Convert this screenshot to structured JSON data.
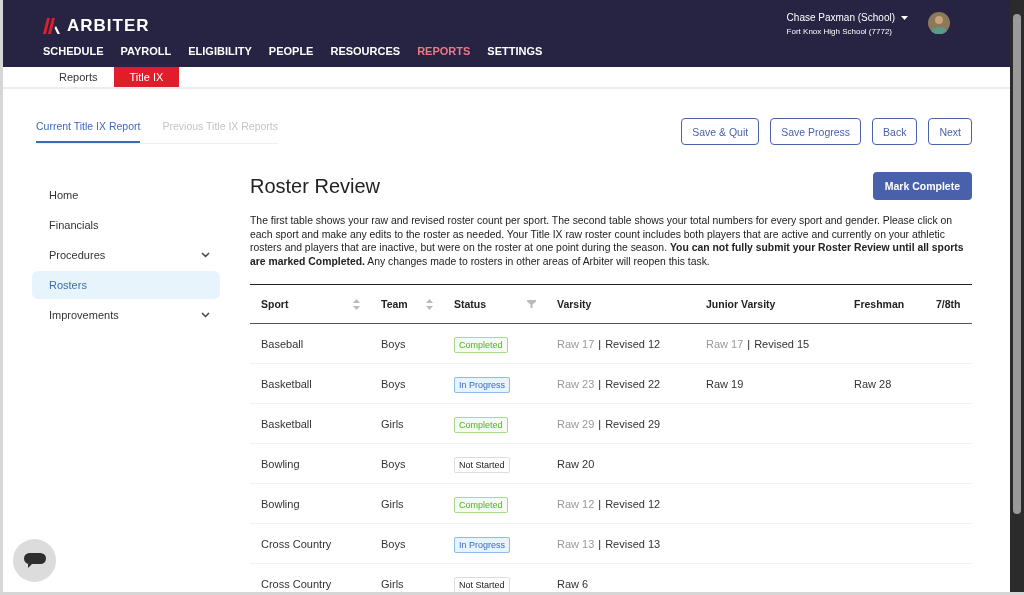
{
  "brand": {
    "name": "ARBITER"
  },
  "nav": [
    {
      "label": "SCHEDULE",
      "selected": false
    },
    {
      "label": "PAYROLL",
      "selected": false
    },
    {
      "label": "ELIGIBILITY",
      "selected": false
    },
    {
      "label": "PEOPLE",
      "selected": false
    },
    {
      "label": "RESOURCES",
      "selected": false
    },
    {
      "label": "REPORTS",
      "selected": true
    },
    {
      "label": "SETTINGS",
      "selected": false
    }
  ],
  "user": {
    "name": "Chase Paxman (School)",
    "school": "Fort Knox High School (7772)"
  },
  "subnav": [
    {
      "label": "Reports",
      "selected": false
    },
    {
      "label": "Title IX",
      "selected": true
    }
  ],
  "report_tabs": [
    {
      "label": "Current Title IX Report",
      "selected": true
    },
    {
      "label": "Previous Title IX Reports",
      "selected": false
    }
  ],
  "actions": [
    "Save & Quit",
    "Save Progress",
    "Back",
    "Next"
  ],
  "sidebar": {
    "items": [
      {
        "label": "Home",
        "selected": false
      },
      {
        "label": "Financials",
        "selected": false
      },
      {
        "label": "Procedures",
        "selected": false,
        "expandable": true
      },
      {
        "label": "Rosters",
        "selected": true
      },
      {
        "label": "Improvements",
        "selected": false,
        "expandable": true
      }
    ]
  },
  "title": "Roster Review",
  "mark_complete": "Mark Complete",
  "description": "The first table shows your raw and revised roster count per sport. The second table shows your total numbers for every sport and gender. Please click on each sport and make any edits to the roster as needed. Your Title IX raw roster count includes both players that are active and currently on your athletic rosters and players that are inactive, but were on the roster at one point during the season. **You can not fully submit your Roster Review until all sports are marked Completed.** Any changes made to rosters in other areas of Arbiter will reopen this task.",
  "table": {
    "columns": [
      {
        "label": "Sport",
        "sortable": true
      },
      {
        "label": "Team",
        "sortable": true
      },
      {
        "label": "Status",
        "filterable": true
      },
      {
        "label": "Varsity"
      },
      {
        "label": "Junior Varsity"
      },
      {
        "label": "Freshman"
      },
      {
        "label": "7/8th"
      }
    ],
    "rows": [
      {
        "sport": "Baseball",
        "team": "Boys",
        "status": {
          "kind": "completed",
          "label": "Completed"
        },
        "varsity": {
          "raw": "Raw 17",
          "separator": "|",
          "revised": "Revised 12"
        },
        "junior_varsity": {
          "raw": "Raw 17",
          "separator": "|",
          "revised": "Revised 15"
        }
      },
      {
        "sport": "Basketball",
        "team": "Boys",
        "status": {
          "kind": "in_progress",
          "label": "In Progress"
        },
        "varsity": {
          "raw": "Raw 23",
          "separator": "|",
          "revised": "Revised 22"
        },
        "junior_varsity": {
          "raw": "Raw 19"
        },
        "freshman": {
          "raw": "Raw 28"
        }
      },
      {
        "sport": "Basketball",
        "team": "Girls",
        "status": {
          "kind": "completed",
          "label": "Completed"
        },
        "varsity": {
          "raw": "Raw 29",
          "separator": "|",
          "revised": "Revised 29"
        }
      },
      {
        "sport": "Bowling",
        "team": "Boys",
        "status": {
          "kind": "not_started",
          "label": "Not Started"
        },
        "varsity": {
          "raw": "Raw 20"
        }
      },
      {
        "sport": "Bowling",
        "team": "Girls",
        "status": {
          "kind": "completed",
          "label": "Completed"
        },
        "varsity": {
          "raw": "Raw 12",
          "separator": "|",
          "revised": "Revised 12"
        }
      },
      {
        "sport": "Cross Country",
        "team": "Boys",
        "status": {
          "kind": "in_progress",
          "label": "In Progress"
        },
        "varsity": {
          "raw": "Raw 13",
          "separator": "|",
          "revised": "Revised 13"
        }
      },
      {
        "sport": "Cross Country",
        "team": "Girls",
        "status": {
          "kind": "not_started",
          "label": "Not Started"
        },
        "varsity": {
          "raw": "Raw 6"
        }
      }
    ]
  }
}
